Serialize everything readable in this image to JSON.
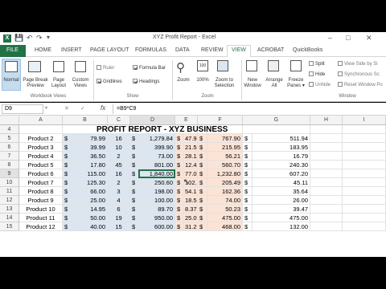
{
  "window": {
    "title": "XYZ Profit Report - Excel",
    "min_btn": "–",
    "max_btn": "□",
    "close_btn": "✕"
  },
  "tabs": [
    {
      "label": "FILE",
      "active": false,
      "file": true
    },
    {
      "label": "HOME"
    },
    {
      "label": "INSERT"
    },
    {
      "label": "PAGE LAYOUT"
    },
    {
      "label": "FORMULAS"
    },
    {
      "label": "DATA"
    },
    {
      "label": "REVIEW"
    },
    {
      "label": "VIEW",
      "active": true
    },
    {
      "label": "ACROBAT"
    },
    {
      "label": "QuickBooks"
    }
  ],
  "ribbon": {
    "normal": "Normal",
    "page_break": [
      "Page Break",
      "Preview"
    ],
    "page_layout": [
      "Page",
      "Layout"
    ],
    "custom_views": [
      "Custom",
      "Views"
    ],
    "group_workbook_views": "Workbook Views",
    "ruler": "Ruler",
    "gridlines": "Gridlines",
    "formula_bar": "Formula Bar",
    "headings": "Headings",
    "group_show": "Show",
    "zoom": "Zoom",
    "zoom_100": "100%",
    "zoom_selection": [
      "Zoom to",
      "Selection"
    ],
    "group_zoom": "Zoom",
    "new_window": [
      "New",
      "Window"
    ],
    "arrange_all": [
      "Arrange",
      "All"
    ],
    "freeze_panes": [
      "Freeze",
      "Panes ▾"
    ],
    "split": "Split",
    "hide": "Hide",
    "unhide": "Unhide",
    "view_side_by_side": "View Side by Si",
    "sync_scroll": "Synchronous Sc",
    "reset_window": "Reset Window Po",
    "group_window": "Window"
  },
  "formula_bar": {
    "name_box": "D9",
    "fx": "fx",
    "cancel": "✕",
    "enter": "✓",
    "formula": "=B9*C9"
  },
  "columns": [
    "A",
    "B",
    "C",
    "D",
    "E",
    "F",
    "G",
    "H",
    "I"
  ],
  "title_row": {
    "row": "4",
    "text": "PROFIT REPORT - XYZ BUSINESS"
  },
  "rows": [
    {
      "row": "5",
      "product": "Product 2",
      "b": "79.99",
      "c": "16",
      "d": "1,279.84",
      "e": "47.99",
      "f": "767.90",
      "g": "511.94"
    },
    {
      "row": "6",
      "product": "Product 3",
      "b": "39.99",
      "c": "10",
      "d": "399.90",
      "e": "21.59",
      "f": "215.95",
      "g": "183.95"
    },
    {
      "row": "7",
      "product": "Product 4",
      "b": "36.50",
      "c": "2",
      "d": "73.00",
      "e": "28.11",
      "f": "56.21",
      "g": "16.79"
    },
    {
      "row": "8",
      "product": "Product 5",
      "b": "17.80",
      "c": "45",
      "d": "801.00",
      "e": "12.46",
      "f": "560.70",
      "g": "240.30"
    },
    {
      "row": "9",
      "product": "Product 6",
      "b": "115.00",
      "c": "16",
      "d": "1,840.00",
      "e": "77.05",
      "f": "1,232.80",
      "g": "607.20",
      "selected": true
    },
    {
      "row": "10",
      "product": "Product 7",
      "b": "125.30",
      "c": "2",
      "d": "250.60",
      "e": "102.75",
      "f": "205.49",
      "g": "45.11"
    },
    {
      "row": "11",
      "product": "Product 8",
      "b": "66.00",
      "c": "3",
      "d": "198.00",
      "e": "54.12",
      "f": "162.36",
      "g": "35.64"
    },
    {
      "row": "12",
      "product": "Product 9",
      "b": "25.00",
      "c": "4",
      "d": "100.00",
      "e": "18.50",
      "f": "74.00",
      "g": "26.00"
    },
    {
      "row": "13",
      "product": "Product 10",
      "b": "14.95",
      "c": "6",
      "d": "89.70",
      "e": "8.37",
      "f": "50.23",
      "g": "39.47"
    },
    {
      "row": "14",
      "product": "Product 11",
      "b": "50.00",
      "c": "19",
      "d": "950.00",
      "e": "25.00",
      "f": "475.00",
      "g": "475.00"
    },
    {
      "row": "15",
      "product": "Product 12",
      "b": "40.00",
      "c": "15",
      "d": "600.00",
      "e": "31.20",
      "f": "468.00",
      "g": "132.00"
    }
  ],
  "currency": "$"
}
